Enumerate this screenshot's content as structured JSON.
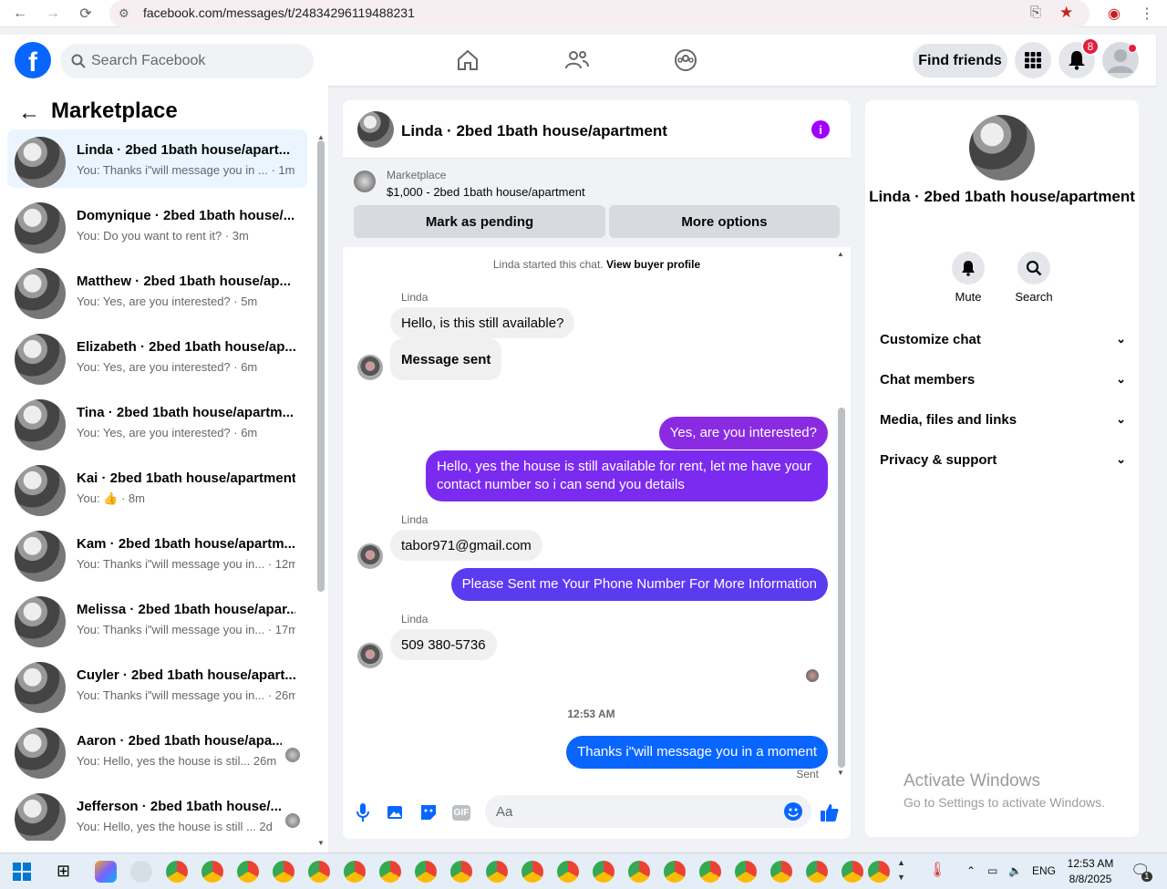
{
  "browser": {
    "url": "facebook.com/messages/t/24834296119488231"
  },
  "header": {
    "search_placeholder": "Search Facebook",
    "find_friends": "Find friends",
    "notification_count": "8"
  },
  "sidebar": {
    "title": "Marketplace",
    "conversations": [
      {
        "name": "Linda · 2bed 1bath house/apart...",
        "preview": "You: Thanks i\"will message you in ... · 1m"
      },
      {
        "name": "Domynique · 2bed 1bath house/...",
        "preview": "You: Do you want to rent it? · 3m"
      },
      {
        "name": "Matthew · 2bed 1bath house/ap...",
        "preview": "You: Yes, are you interested? · 5m"
      },
      {
        "name": "Elizabeth · 2bed 1bath house/ap...",
        "preview": "You: Yes, are you interested? · 6m"
      },
      {
        "name": "Tina · 2bed 1bath house/apartm...",
        "preview": "You: Yes, are you interested? · 6m"
      },
      {
        "name": "Kai · 2bed 1bath house/apartment",
        "preview": "You: 👍 · 8m"
      },
      {
        "name": "Kam · 2bed 1bath house/apartm...",
        "preview": "You: Thanks i\"will message you in... · 12m"
      },
      {
        "name": "Melissa · 2bed 1bath house/apar...",
        "preview": "You: Thanks i\"will message you in... · 17m"
      },
      {
        "name": "Cuyler · 2bed 1bath house/apart...",
        "preview": "You: Thanks i\"will message you in... · 26m"
      },
      {
        "name": "Aaron · 2bed 1bath house/apa...",
        "preview": "You: Hello, yes the house is stil... 26m"
      },
      {
        "name": "Jefferson · 2bed 1bath house/...",
        "preview": "You: Hello, yes the house is still ... 2d"
      }
    ]
  },
  "chat": {
    "title": "Linda · 2bed 1bath house/apartment",
    "marketplace_label": "Marketplace",
    "listing": "$1,000 - 2bed 1bath house/apartment",
    "mark_pending": "Mark as pending",
    "more_options": "More options",
    "started_text": "Linda started this chat.",
    "view_profile": "View buyer profile",
    "sender": "Linda",
    "messages": {
      "m1": "Hello, is this still available?",
      "m2": "Message sent",
      "m3": "Yes, are you interested?",
      "m4": "Hello, yes the house is still available for rent, let me have your contact number so i can send you details",
      "m5": "tabor971@gmail.com",
      "m6": "Please Sent me Your Phone Number For More Information",
      "m7": "509 380-5736",
      "m8": "Thanks i\"will message you in a moment"
    },
    "time": "12:53 AM",
    "sent_status": "Sent",
    "composer_placeholder": "Aa"
  },
  "details": {
    "name": "Linda · 2bed 1bath house/apartment",
    "mute": "Mute",
    "search": "Search",
    "sections": [
      "Customize chat",
      "Chat members",
      "Media, files and links",
      "Privacy & support"
    ]
  },
  "watermark": {
    "title": "Activate Windows",
    "subtitle": "Go to Settings to activate Windows."
  },
  "taskbar": {
    "lang": "ENG",
    "time": "12:53 AM",
    "date": "8/8/2025",
    "notif_count": "1"
  },
  "colors": {
    "fb_blue": "#0866ff",
    "bubble_purple": "#8a2be2",
    "bubble_blue": "#0866ff"
  }
}
